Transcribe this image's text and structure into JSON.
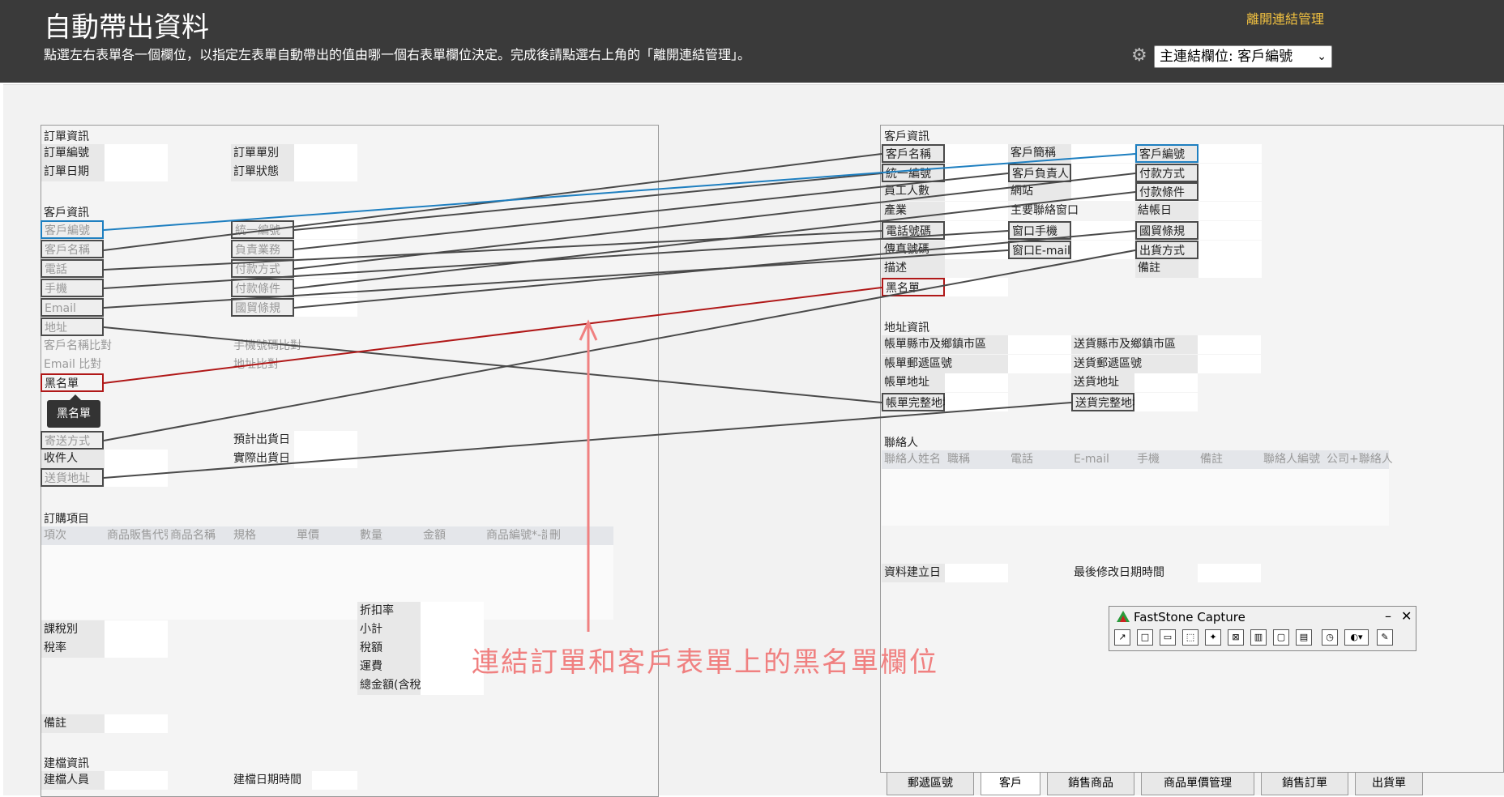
{
  "header": {
    "title": "自動帶出資料",
    "description": "點選左右表單各一個欄位，以指定左表單自動帶出的值由哪一個右表單欄位決定。完成後請點選右上角的「離開連結管理」。",
    "leave_link": "離開連結管理",
    "main_link_select": "主連結欄位: 客戶編號"
  },
  "left_form": {
    "sec_order": "訂單資訊",
    "order_no": "訂單編號",
    "order_type": "訂單單別",
    "order_date": "訂單日期",
    "order_status": "訂單狀態",
    "sec_customer": "客戶資訊",
    "cust_no": "客戶編號",
    "unified_no": "統一編號",
    "cust_name": "客戶名稱",
    "sales": "負責業務",
    "phone": "電話",
    "pay_method": "付款方式",
    "mobile": "手機",
    "pay_terms": "付款條件",
    "email": "Email",
    "trade_terms": "國貿條規",
    "address": "地址",
    "name_match": "客戶名稱比對",
    "mobile_match": "手機號碼比對",
    "email_match": "Email 比對",
    "addr_match": "地址比對",
    "blacklist": "黑名單",
    "ship_method": "寄送方式",
    "est_ship": "預計出貨日",
    "receiver": "收件人",
    "actual_ship": "實際出貨日",
    "ship_addr": "送貨地址",
    "sec_items": "訂購項目",
    "item_headers": [
      "項次",
      "商品販售代號",
      "商品名稱",
      "規格",
      "單價",
      "數量",
      "金額",
      "商品編號*-讀取",
      "刪"
    ],
    "discount": "折扣率",
    "subtotal": "小計",
    "tax_type": "課稅別",
    "tax_amt": "稅額",
    "tax_rate": "稅率",
    "freight": "運費",
    "total": "總金額(含稅)",
    "remark": "備註",
    "sec_build": "建檔資訊",
    "builder": "建檔人員",
    "build_date": "建檔日期時間"
  },
  "tooltip": "黑名單",
  "right_form": {
    "sec_customer": "客戶資訊",
    "cust_name": "客戶名稱",
    "short_name": "客戶簡稱",
    "cust_no": "客戶編號",
    "unified_no": "統一編號",
    "owner": "客戶負責人",
    "pay_method": "付款方式",
    "employees": "員工人數",
    "website": "網站",
    "pay_terms": "付款條件",
    "industry": "產業",
    "main_contact": "主要聯絡窗口",
    "closing_day": "結帳日",
    "phone": "電話號碼",
    "win_mobile": "窗口手機",
    "trade_terms": "國貿條規",
    "fax": "傳真號碼",
    "win_email": "窗口E-mail",
    "ship_method": "出貨方式",
    "desc": "描述",
    "remark": "備註",
    "blacklist": "黑名單",
    "sec_address": "地址資訊",
    "bill_city": "帳單縣市及鄉鎮市區",
    "ship_city": "送貨縣市及鄉鎮市區",
    "bill_zip": "帳單郵遞區號",
    "ship_zip": "送貨郵遞區號",
    "bill_addr": "帳單地址",
    "ship_addr": "送貨地址",
    "bill_full": "帳單完整地址",
    "ship_full": "送貨完整地址",
    "sec_contact": "聯絡人",
    "contact_headers": [
      "聯絡人姓名",
      "職稱",
      "電話",
      "E-mail",
      "手機",
      "備註",
      "聯絡人編號",
      "公司+聯絡人"
    ],
    "created": "資料建立日",
    "modified": "最後修改日期時間"
  },
  "annotation": "連結訂單和客戶表單上的黑名單欄位",
  "tabs": [
    "郵遞區號",
    "客戶",
    "銷售商品",
    "商品單價管理",
    "銷售訂單",
    "出貨單"
  ],
  "faststone": {
    "title": "FastStone Capture",
    "minimize": "–",
    "close": "✕"
  },
  "colors": {
    "header_bg": "#3a3a3a",
    "leave_link": "#f0c040",
    "link_line": "#4a4a4a",
    "main_link": "#1e7fc0",
    "black_link": "#b01818",
    "annotation": "#f08080"
  }
}
